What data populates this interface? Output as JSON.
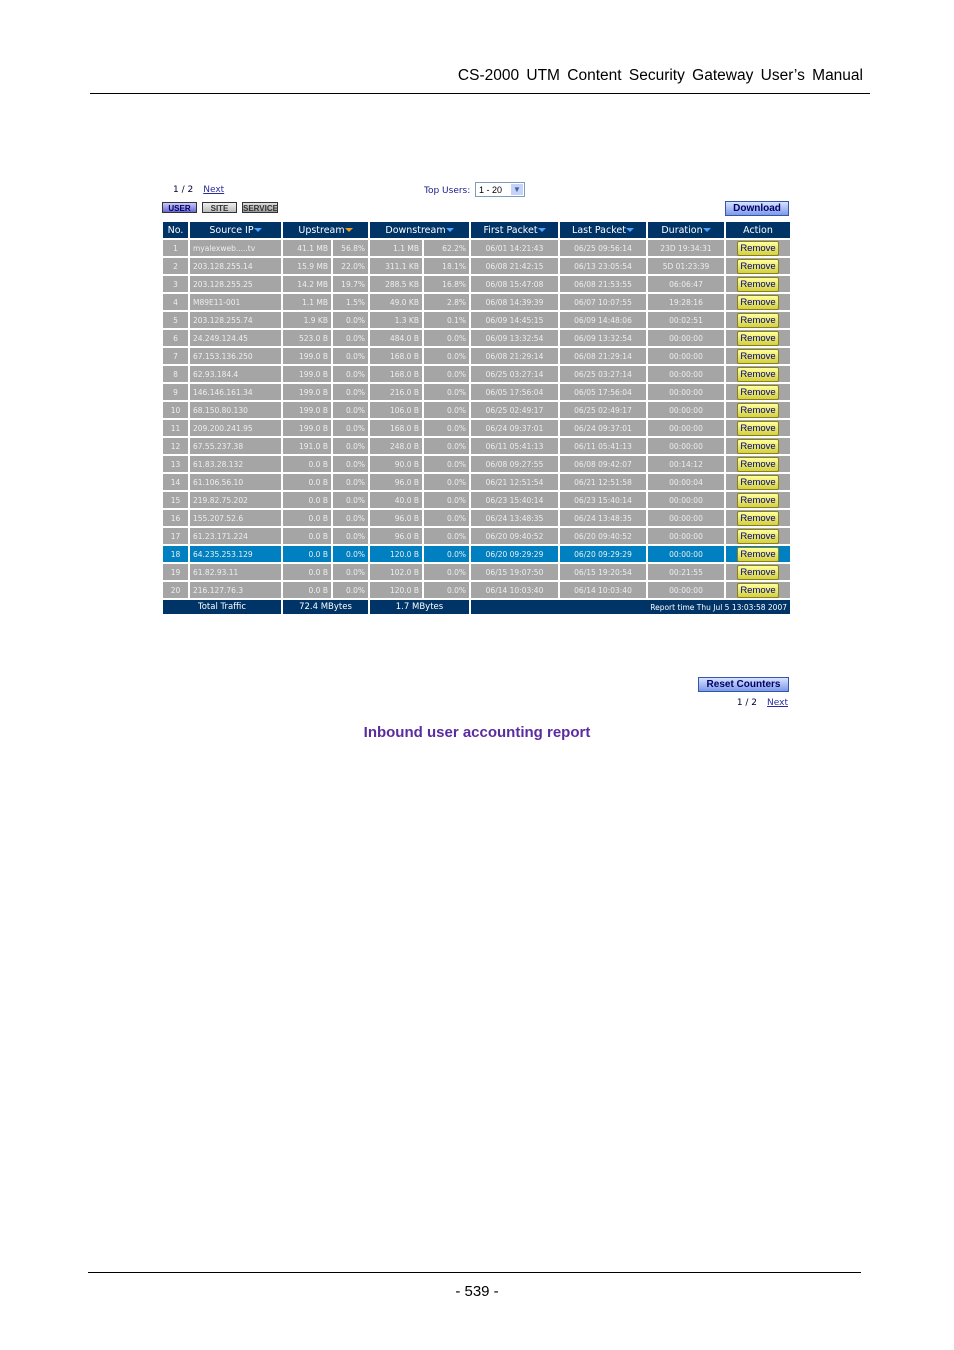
{
  "header": {
    "title": "CS-2000  UTM  Content  Security  Gateway  User’s  Manual"
  },
  "footer": {
    "page": "- 539 -"
  },
  "report": {
    "pager": {
      "page": "1 / 2",
      "next": "Next"
    },
    "top_users_label": "Top Users:",
    "top_users_value": "1 - 20",
    "tabs": [
      "USER",
      "SITE",
      "SERVICE"
    ],
    "download": "Download",
    "columns": [
      "No.",
      "Source IP",
      "Upstream",
      "Downstream",
      "First Packet",
      "Last Packet",
      "Duration",
      "Action"
    ],
    "rows": [
      [
        "1",
        "myalexweb.....tv",
        "41.1 MB",
        "56.8%",
        "1.1 MB",
        "62.2%",
        "06/01 14:21:43",
        "06/25 09:56:14",
        "23D 19:34:31"
      ],
      [
        "2",
        "203.128.255.14",
        "15.9 MB",
        "22.0%",
        "311.1 KB",
        "18.1%",
        "06/08 21:42:15",
        "06/13 23:05:54",
        "5D 01:23:39"
      ],
      [
        "3",
        "203.128.255.25",
        "14.2 MB",
        "19.7%",
        "288.5 KB",
        "16.8%",
        "06/08 15:47:08",
        "06/08 21:53:55",
        "06:06:47"
      ],
      [
        "4",
        "M89E11-001",
        "1.1 MB",
        "1.5%",
        "49.0 KB",
        "2.8%",
        "06/08 14:39:39",
        "06/07 10:07:55",
        "19:28:16"
      ],
      [
        "5",
        "203.128.255.74",
        "1.9 KB",
        "0.0%",
        "1.3 KB",
        "0.1%",
        "06/09 14:45:15",
        "06/09 14:48:06",
        "00:02:51"
      ],
      [
        "6",
        "24.249.124.45",
        "523.0 B",
        "0.0%",
        "484.0 B",
        "0.0%",
        "06/09 13:32:54",
        "06/09 13:32:54",
        "00:00:00"
      ],
      [
        "7",
        "67.153.136.250",
        "199.0 B",
        "0.0%",
        "168.0 B",
        "0.0%",
        "06/08 21:29:14",
        "06/08 21:29:14",
        "00:00:00"
      ],
      [
        "8",
        "62.93.184.4",
        "199.0 B",
        "0.0%",
        "168.0 B",
        "0.0%",
        "06/25 03:27:14",
        "06/25 03:27:14",
        "00:00:00"
      ],
      [
        "9",
        "146.146.161.34",
        "199.0 B",
        "0.0%",
        "216.0 B",
        "0.0%",
        "06/05 17:56:04",
        "06/05 17:56:04",
        "00:00:00"
      ],
      [
        "10",
        "68.150.80.130",
        "199.0 B",
        "0.0%",
        "106.0 B",
        "0.0%",
        "06/25 02:49:17",
        "06/25 02:49:17",
        "00:00:00"
      ],
      [
        "11",
        "209.200.241.95",
        "199.0 B",
        "0.0%",
        "168.0 B",
        "0.0%",
        "06/24 09:37:01",
        "06/24 09:37:01",
        "00:00:00"
      ],
      [
        "12",
        "67.55.237.38",
        "191.0 B",
        "0.0%",
        "248.0 B",
        "0.0%",
        "06/11 05:41:13",
        "06/11 05:41:13",
        "00:00:00"
      ],
      [
        "13",
        "61.83.28.132",
        "0.0 B",
        "0.0%",
        "90.0 B",
        "0.0%",
        "06/08 09:27:55",
        "06/08 09:42:07",
        "00:14:12"
      ],
      [
        "14",
        "61.106.56.10",
        "0.0 B",
        "0.0%",
        "96.0 B",
        "0.0%",
        "06/21 12:51:54",
        "06/21 12:51:58",
        "00:00:04"
      ],
      [
        "15",
        "219.82.75.202",
        "0.0 B",
        "0.0%",
        "40.0 B",
        "0.0%",
        "06/23 15:40:14",
        "06/23 15:40:14",
        "00:00:00"
      ],
      [
        "16",
        "155.207.52.6",
        "0.0 B",
        "0.0%",
        "96.0 B",
        "0.0%",
        "06/24 13:48:35",
        "06/24 13:48:35",
        "00:00:00"
      ],
      [
        "17",
        "61.23.171.224",
        "0.0 B",
        "0.0%",
        "96.0 B",
        "0.0%",
        "06/20 09:40:52",
        "06/20 09:40:52",
        "00:00:00"
      ],
      [
        "18",
        "64.235.253.129",
        "0.0 B",
        "0.0%",
        "120.0 B",
        "0.0%",
        "06/20 09:29:29",
        "06/20 09:29:29",
        "00:00:00"
      ],
      [
        "19",
        "61.82.93.11",
        "0.0 B",
        "0.0%",
        "102.0 B",
        "0.0%",
        "06/15 19:07:50",
        "06/15 19:20:54",
        "00:21:55"
      ],
      [
        "20",
        "216.127.76.3",
        "0.0 B",
        "0.0%",
        "120.0 B",
        "0.0%",
        "06/14 10:03:40",
        "06/14 10:03:40",
        "00:00:00"
      ]
    ],
    "remove_label": "Remove",
    "selected_row": 18,
    "total_label": "Total Traffic",
    "total_up": "72.4 MBytes",
    "total_down": "1.7 MBytes",
    "report_time": "Report time Thu Jul 5 13:03:58 2007",
    "reset": "Reset Counters",
    "caption": "Inbound user accounting report"
  }
}
